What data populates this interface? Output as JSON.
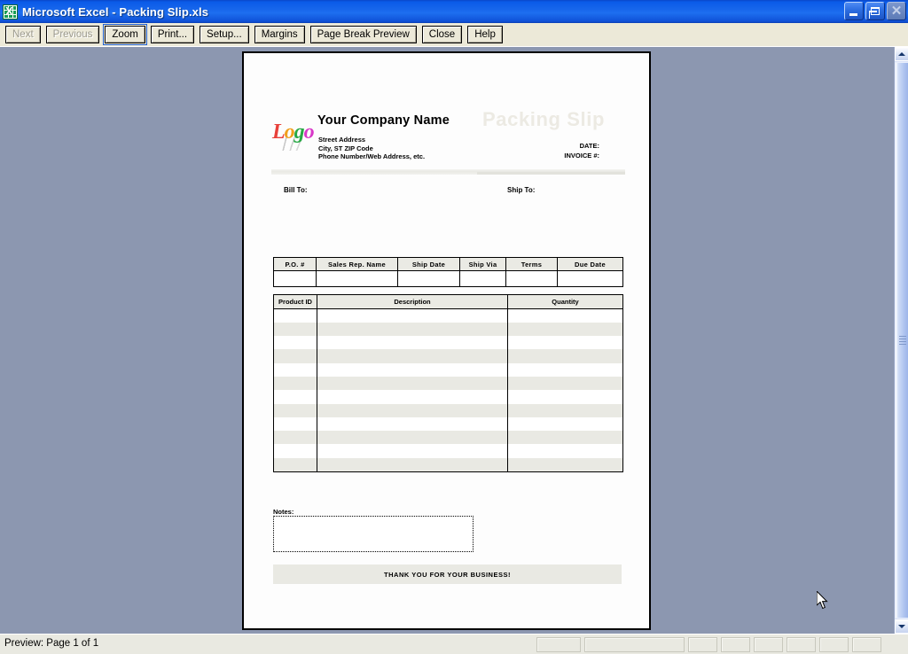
{
  "window": {
    "title": "Microsoft Excel - Packing Slip.xls",
    "app_icon": "excel-icon",
    "icon_letter": "X",
    "controls": {
      "minimize": "minimize-icon",
      "restore": "restore-icon",
      "close": "close-icon",
      "close_glyph": "✕"
    },
    "titlebar_color": "#1968ec"
  },
  "toolbar": {
    "buttons": [
      {
        "label": "Next",
        "name": "next-button",
        "disabled": true
      },
      {
        "label": "Previous",
        "name": "previous-button",
        "disabled": true
      },
      {
        "label": "Zoom",
        "name": "zoom-button",
        "disabled": false,
        "focused": true
      },
      {
        "label": "Print...",
        "name": "print-button",
        "disabled": false
      },
      {
        "label": "Setup...",
        "name": "setup-button",
        "disabled": false
      },
      {
        "label": "Margins",
        "name": "margins-button",
        "disabled": false
      },
      {
        "label": "Page Break Preview",
        "name": "page-break-preview-button",
        "disabled": false
      },
      {
        "label": "Close",
        "name": "close-preview-button",
        "disabled": false
      },
      {
        "label": "Help",
        "name": "help-button",
        "disabled": false
      }
    ]
  },
  "document": {
    "company_name": "Your Company Name",
    "address_lines": [
      "Street Address",
      "City, ST  ZIP Code",
      "Phone Number/Web Address, etc."
    ],
    "doc_type": "Packing Slip",
    "meta": [
      "DATE:",
      "INVOICE #:"
    ],
    "bill_to_label": "Bill To:",
    "ship_to_label": "Ship To:",
    "logo": {
      "name": "logo-placeholder",
      "letters": [
        "L",
        "o",
        "g",
        "o"
      ],
      "colors": [
        "#e8403a",
        "#f0a01e",
        "#27a844",
        "#d838c8"
      ]
    },
    "order_table": {
      "headers": [
        "P.O. #",
        "Sales Rep. Name",
        "Ship Date",
        "Ship Via",
        "Terms",
        "Due Date"
      ],
      "rows": [
        [
          "",
          "",
          "",
          "",
          "",
          ""
        ]
      ]
    },
    "items_table": {
      "headers": [
        "Product ID",
        "Description",
        "Quantity"
      ],
      "row_count": 12,
      "rows": [
        [
          "",
          "",
          ""
        ],
        [
          "",
          "",
          ""
        ],
        [
          "",
          "",
          ""
        ],
        [
          "",
          "",
          ""
        ],
        [
          "",
          "",
          ""
        ],
        [
          "",
          "",
          ""
        ],
        [
          "",
          "",
          ""
        ],
        [
          "",
          "",
          ""
        ],
        [
          "",
          "",
          ""
        ],
        [
          "",
          "",
          ""
        ],
        [
          "",
          "",
          ""
        ],
        [
          "",
          "",
          ""
        ]
      ],
      "stripe_color": "#e9e9e3"
    },
    "notes_label": "Notes:",
    "notes_value": "",
    "thanks_banner": "THANK YOU FOR YOUR BUSINESS!"
  },
  "statusbar": {
    "text": "Preview: Page 1 of 1",
    "panels": [
      {
        "width": 50
      },
      {
        "width": 113
      },
      {
        "width": 33
      },
      {
        "width": 33
      },
      {
        "width": 33
      },
      {
        "width": 33
      },
      {
        "width": 33
      },
      {
        "width": 33
      }
    ]
  },
  "scrollbar": {
    "up_arrow": "scroll-up-arrow",
    "down_arrow": "scroll-down-arrow",
    "thumb": "scroll-thumb"
  }
}
